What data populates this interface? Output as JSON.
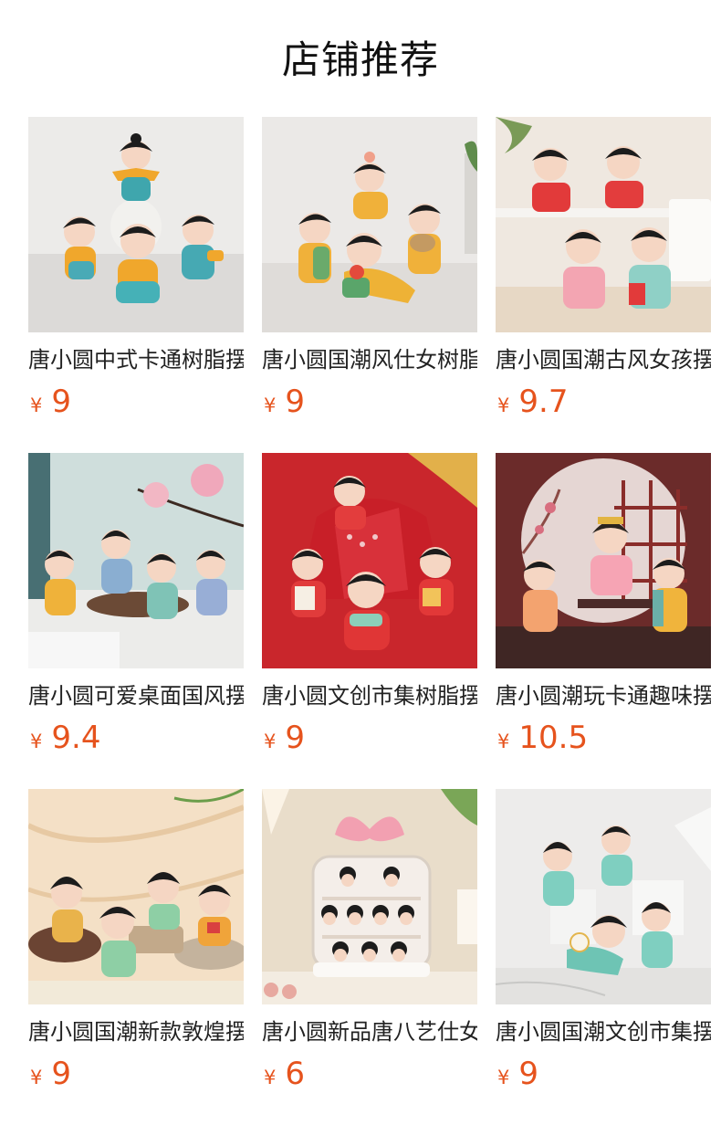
{
  "page_title": "店铺推荐",
  "currency_symbol": "¥",
  "accent_color": "#e6531d",
  "products": [
    {
      "name": "唐小圆中式卡通树脂摆件",
      "price": "9"
    },
    {
      "name": "唐小圆国潮风仕女树脂摆件",
      "price": "9"
    },
    {
      "name": "唐小圆国潮古风女孩摆件",
      "price": "9.7"
    },
    {
      "name": "唐小圆可爱桌面国风摆件",
      "price": "9.4"
    },
    {
      "name": "唐小圆文创市集树脂摆件",
      "price": "9"
    },
    {
      "name": "唐小圆潮玩卡通趣味摆件",
      "price": "10.5"
    },
    {
      "name": "唐小圆国潮新款敦煌摆件",
      "price": "9"
    },
    {
      "name": "唐小圆新品唐八艺仕女摆件",
      "price": "6"
    },
    {
      "name": "唐小圆国潮文创市集摆件",
      "price": "9"
    }
  ]
}
